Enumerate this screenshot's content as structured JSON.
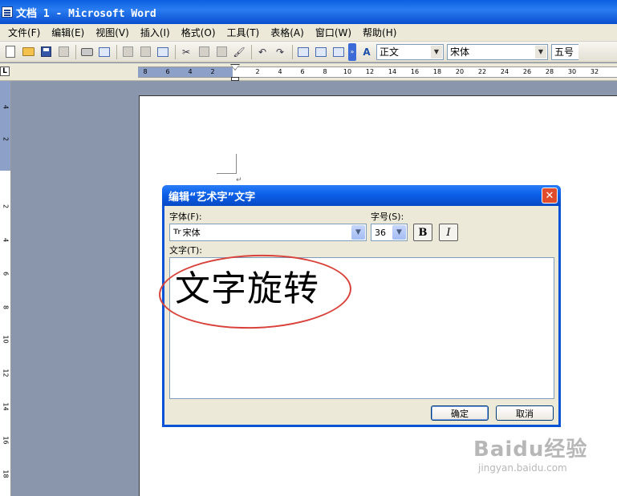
{
  "window": {
    "title": "文档 1 - Microsoft Word"
  },
  "menu": [
    "文件(F)",
    "编辑(E)",
    "视图(V)",
    "插入(I)",
    "格式(O)",
    "工具(T)",
    "表格(A)",
    "窗口(W)",
    "帮助(H)"
  ],
  "toolbar": {
    "style_value": "正文",
    "font_value": "宋体",
    "size_value": "五号"
  },
  "ruler": {
    "corner": "L",
    "left_ticks": [
      "8",
      "6",
      "4",
      "2"
    ],
    "right_ticks": [
      "2",
      "4",
      "6",
      "8",
      "10",
      "12",
      "14",
      "16",
      "18",
      "20",
      "22",
      "24",
      "26",
      "28",
      "30",
      "32"
    ],
    "vertical_ticks": [
      "4",
      "2",
      "2",
      "4",
      "6",
      "8",
      "10",
      "12",
      "14",
      "16",
      "18"
    ]
  },
  "dialog": {
    "title": "编辑“艺术字”文字",
    "font_label": "字体(F):",
    "font_value": "宋体",
    "font_icon": "Tr",
    "size_label": "字号(S):",
    "size_value": "36",
    "bold_label": "B",
    "italic_label": "I",
    "text_label": "文字(T):",
    "text_value": "文字旋转",
    "ok_label": "确定",
    "cancel_label": "取消"
  },
  "watermark": {
    "logo": "Baidu经验",
    "url": "jingyan.baidu.com"
  },
  "colors": {
    "title_blue": "#0a5fe8",
    "annotation_red": "#d9423a",
    "face": "#ece9d8"
  }
}
